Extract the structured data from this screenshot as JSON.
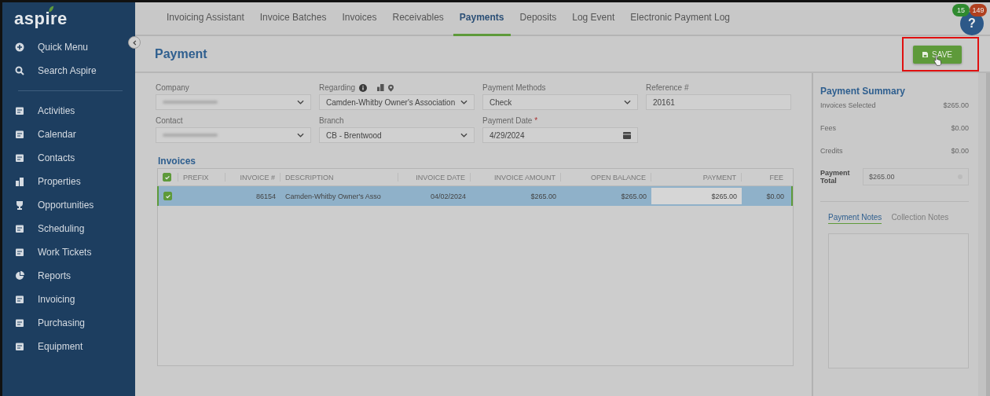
{
  "sidebar": {
    "logo": "aspire",
    "items": [
      {
        "label": "Quick Menu"
      },
      {
        "label": "Search Aspire"
      },
      {
        "label": "Activities"
      },
      {
        "label": "Calendar"
      },
      {
        "label": "Contacts"
      },
      {
        "label": "Properties"
      },
      {
        "label": "Opportunities"
      },
      {
        "label": "Scheduling"
      },
      {
        "label": "Work Tickets"
      },
      {
        "label": "Reports"
      },
      {
        "label": "Invoicing"
      },
      {
        "label": "Purchasing"
      },
      {
        "label": "Equipment"
      }
    ]
  },
  "nav": {
    "tabs": [
      {
        "label": "Invoicing Assistant",
        "selected": false
      },
      {
        "label": "Invoice Batches",
        "selected": false
      },
      {
        "label": "Invoices",
        "selected": false
      },
      {
        "label": "Receivables",
        "selected": false
      },
      {
        "label": "Payments",
        "selected": true
      },
      {
        "label": "Deposits",
        "selected": false
      },
      {
        "label": "Log Event",
        "selected": false
      },
      {
        "label": "Electronic Payment Log",
        "selected": false
      }
    ],
    "badges": [
      {
        "count": "15",
        "color": "#2f8a2f"
      },
      {
        "count": "149",
        "color": "#b0401f"
      }
    ],
    "help": "?"
  },
  "header": {
    "title": "Payment",
    "save_button": "SAVE",
    "highlighted": true
  },
  "form": {
    "rows": [
      [
        {
          "label": "Company",
          "kind": "select",
          "blurred": true,
          "required": false
        },
        {
          "label": "Regarding",
          "kind": "select",
          "value": "Camden-Whitby Owner's Association",
          "blurred": false,
          "required": false,
          "info": true
        },
        {
          "label": "Payment Methods",
          "kind": "select",
          "value": "Check",
          "blurred": false,
          "required": false
        },
        {
          "label": "Reference #",
          "kind": "text",
          "value": "20161",
          "blurred": false,
          "required": false
        }
      ],
      [
        {
          "label": "Contact",
          "kind": "select",
          "blurred": true,
          "required": false
        },
        {
          "label": "Branch",
          "kind": "select",
          "value": "CB - Brentwood",
          "blurred": false,
          "required": false
        },
        {
          "label": "Payment Date",
          "kind": "date",
          "value": "4/29/2024",
          "blurred": false,
          "required": true,
          "req_mark": "*"
        }
      ]
    ]
  },
  "invoices": {
    "title": "Invoices",
    "all_checked": true,
    "columns": [
      "PREFIX",
      "INVOICE #",
      "DESCRIPTION",
      "INVOICE DATE",
      "INVOICE AMOUNT",
      "OPEN BALANCE",
      "PAYMENT",
      "FEE"
    ],
    "rows": [
      {
        "checked": true,
        "selected": true,
        "cells": [
          null,
          "86154",
          "Camden-Whitby Owner's Asso",
          "04/02/2024",
          "$265.00",
          "$265.00",
          "$265.00",
          "$0.00"
        ]
      }
    ]
  },
  "summary": {
    "title": "Payment Summary",
    "lines": [
      {
        "label": "Invoices Selected",
        "value": "$265.00"
      },
      {
        "label": "Fees",
        "value": "$0.00"
      },
      {
        "label": "Credits",
        "value": "$0.00"
      }
    ],
    "total_label": "Payment Total",
    "total_value": "$265.00",
    "note_tabs": [
      {
        "label": "Payment Notes",
        "selected": true
      },
      {
        "label": "Collection Notes",
        "selected": false
      }
    ]
  }
}
